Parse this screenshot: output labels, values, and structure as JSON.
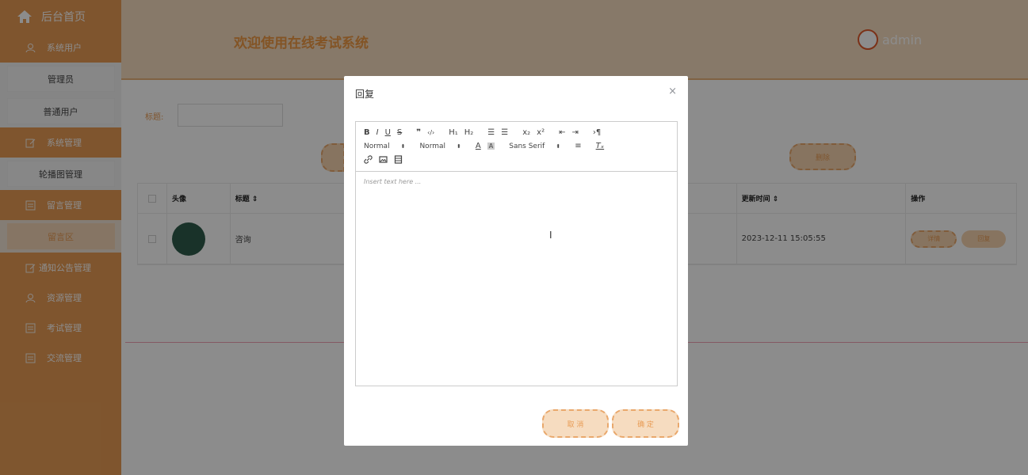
{
  "sidebar": {
    "home_label": "后台首页",
    "items": [
      {
        "type": "group",
        "label": "系统用户",
        "icon": "user-icon"
      },
      {
        "type": "sub",
        "label": "管理员"
      },
      {
        "type": "sub",
        "label": "普通用户"
      },
      {
        "type": "group",
        "label": "系统管理",
        "icon": "edit-icon"
      },
      {
        "type": "sub",
        "label": "轮播图管理"
      },
      {
        "type": "group",
        "label": "留言管理",
        "icon": "list-icon"
      },
      {
        "type": "sub",
        "label": "留言区",
        "active": true
      },
      {
        "type": "group",
        "label": "通知公告管理",
        "icon": "edit-icon"
      },
      {
        "type": "group",
        "label": "资源管理",
        "icon": "user-icon"
      },
      {
        "type": "group",
        "label": "考试管理",
        "icon": "list-icon"
      },
      {
        "type": "group",
        "label": "交流管理",
        "icon": "list-icon"
      }
    ]
  },
  "header": {
    "title": "欢迎使用在线考试系统",
    "username": "admin"
  },
  "search": {
    "label": "标题:",
    "value": "",
    "delete_label": "删除"
  },
  "table": {
    "headers": {
      "avatar": "头像",
      "title": "标题 ⇕",
      "updated": "更新时间 ⇕",
      "actions": "操作"
    },
    "rows": [
      {
        "title": "咨询",
        "updated": "2023-12-11 15:05:55",
        "detail": "详情",
        "reply": "回复"
      }
    ]
  },
  "dialog": {
    "title": "回复",
    "close": "×",
    "placeholder": "Insert text here ...",
    "pickers": {
      "size": "Normal",
      "header": "Normal",
      "font": "Sans Serif"
    },
    "cancel_label": "取 消",
    "ok_label": "确 定"
  },
  "colors": {
    "sidebar": "#e89c55",
    "accent": "#ee9a44",
    "header_bg": "#f6dcc0",
    "button_bg": "#f6d4b0"
  }
}
